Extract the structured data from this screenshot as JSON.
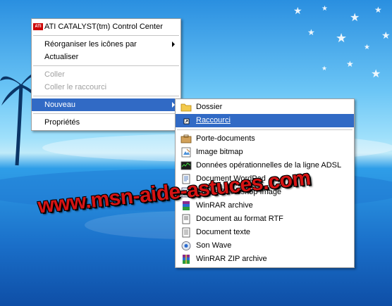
{
  "context_menu": {
    "items": [
      {
        "label": "ATI CATALYST(tm) Control Center",
        "icon": "ati-logo-icon",
        "logo_text": "ATI"
      },
      {
        "separator": true
      },
      {
        "label": "Réorganiser les icônes par",
        "submenu": true
      },
      {
        "label": "Actualiser"
      },
      {
        "separator": true
      },
      {
        "label": "Coller",
        "disabled": true
      },
      {
        "label": "Coller le raccourci",
        "disabled": true
      },
      {
        "separator": true
      },
      {
        "label": "Nouveau",
        "submenu": true,
        "highlighted": true
      },
      {
        "separator": true
      },
      {
        "label": "Propriétés"
      }
    ]
  },
  "submenu_nouveau": {
    "items": [
      {
        "label": "Dossier",
        "icon": "folder-icon"
      },
      {
        "label": "Raccourci",
        "icon": "shortcut-icon",
        "highlighted": true
      },
      {
        "separator": true
      },
      {
        "label": "Porte-documents",
        "icon": "briefcase-icon"
      },
      {
        "label": "Image bitmap",
        "icon": "bitmap-image-icon"
      },
      {
        "label": "Données opérationnelles de la ligne ADSL",
        "icon": "adsl-data-icon"
      },
      {
        "label": "Document WordPad",
        "icon": "wordpad-document-icon"
      },
      {
        "label": "Adobe Photoshop Image",
        "icon": "photoshop-image-icon"
      },
      {
        "label": "WinRAR archive",
        "icon": "winrar-archive-icon"
      },
      {
        "label": "Document au format RTF",
        "icon": "rtf-document-icon"
      },
      {
        "label": "Document texte",
        "icon": "text-document-icon"
      },
      {
        "label": "Son Wave",
        "icon": "wave-sound-icon"
      },
      {
        "label": "WinRAR ZIP archive",
        "icon": "winrar-zip-archive-icon"
      }
    ]
  },
  "watermark": {
    "text": "www.msn-aide-astuces.com"
  },
  "colors": {
    "highlight": "#316ac5",
    "watermark": "#d61414"
  }
}
